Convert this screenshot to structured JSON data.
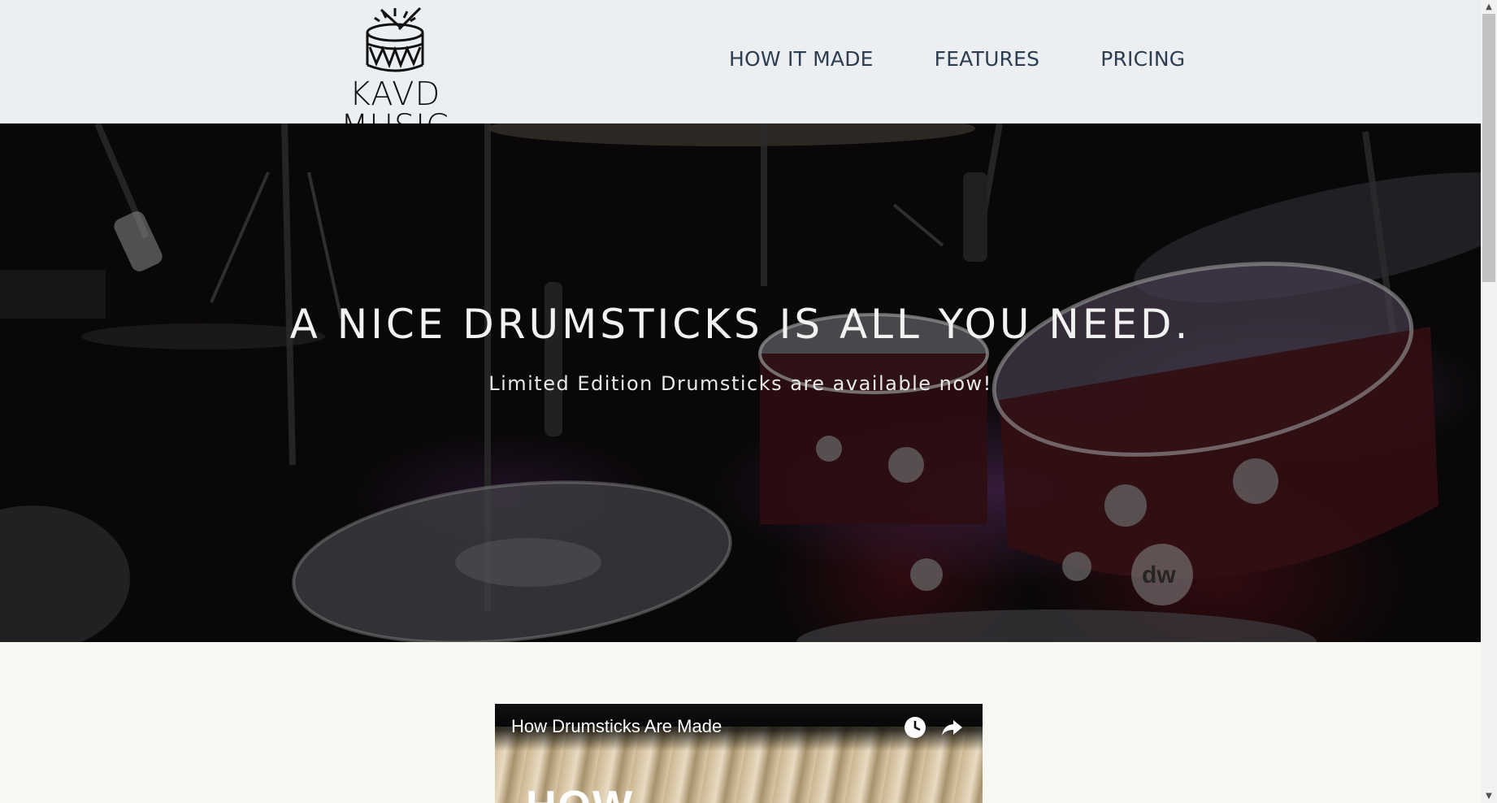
{
  "header": {
    "logo_text": "KAVD MUSIC",
    "nav": [
      {
        "label": "HOW IT MADE"
      },
      {
        "label": "FEATURES"
      },
      {
        "label": "PRICING"
      }
    ]
  },
  "hero": {
    "title": "A NICE DRUMSTICKS IS ALL YOU NEED.",
    "subtitle": "Limited Edition Drumsticks are available now!"
  },
  "video": {
    "title": "How Drumsticks Are Made",
    "overlay_text": "HOW",
    "icons": [
      "watch-later-icon",
      "share-icon"
    ]
  },
  "colors": {
    "header_bg": "#eceff1",
    "nav_text": "#2c3e50",
    "page_bg": "#f7f8f2",
    "hero_bg": "#0c0a0b"
  }
}
